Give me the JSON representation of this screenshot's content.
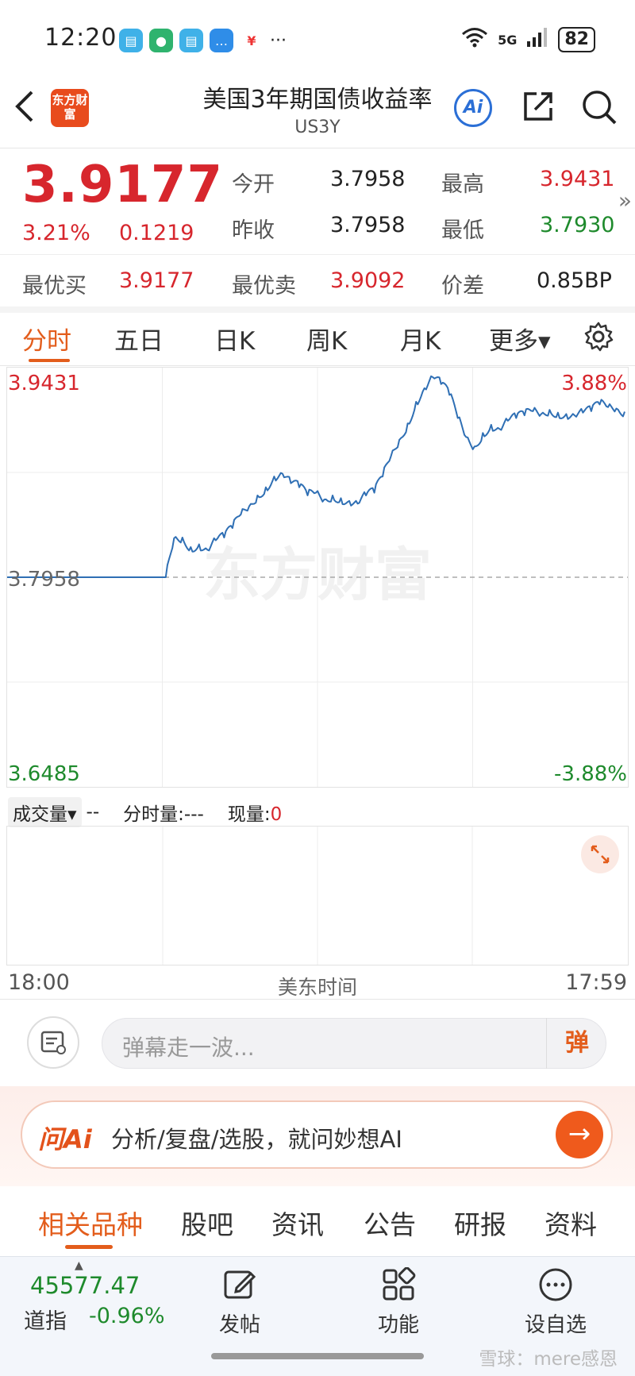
{
  "status_bar": {
    "time": "12:20",
    "network": "5G",
    "battery": "82",
    "more": "···"
  },
  "header": {
    "title": "美国3年期国债收益率",
    "code": "US3Y",
    "logo_text": "东方财富",
    "ai_label": "Ai"
  },
  "quote": {
    "price": "3.9177",
    "change_pct": "3.21%",
    "change_abs": "0.1219",
    "open_label": "今开",
    "open": "3.7958",
    "high_label": "最高",
    "high": "3.9431",
    "prev_close_label": "昨收",
    "prev_close": "3.7958",
    "low_label": "最低",
    "low": "3.7930",
    "best_bid_label": "最优买",
    "best_bid": "3.9177",
    "best_ask_label": "最优卖",
    "best_ask": "3.9092",
    "spread_label": "价差",
    "spread": "0.85BP",
    "more_arrow": "»"
  },
  "tabs": [
    {
      "label": "分时",
      "active": true
    },
    {
      "label": "五日"
    },
    {
      "label": "日K"
    },
    {
      "label": "周K"
    },
    {
      "label": "月K"
    },
    {
      "label": "更多▾"
    }
  ],
  "chart": {
    "y_top": "3.9431",
    "y_mid": "3.7958",
    "y_bottom": "3.6485",
    "pct_top": "3.88%",
    "pct_bottom": "-3.88%",
    "time_start": "18:00",
    "time_center": "美东时间",
    "time_end": "17:59",
    "watermark": "东方财富",
    "colors": {
      "line": "#2f6fb4",
      "up": "#d7262d",
      "down": "#1e8a2c"
    }
  },
  "chart_data": {
    "type": "line",
    "title": "",
    "xlabel": "美东时间",
    "ylabel": "",
    "ylim": [
      3.6485,
      3.9431
    ],
    "x_range": [
      "18:00",
      "17:59"
    ],
    "reference_line": 3.7958,
    "series": [
      {
        "values": [
          3.7958,
          3.7958,
          3.7958,
          3.7958,
          3.7958,
          3.7958,
          3.7958,
          3.7958,
          3.7958,
          3.7958,
          3.7958,
          3.7958,
          3.7958,
          3.7958,
          3.7958,
          3.7958,
          3.7958,
          3.7958,
          3.7958,
          3.7958,
          3.8245,
          3.825,
          3.818,
          3.82,
          3.816,
          3.823,
          3.825,
          3.832,
          3.842,
          3.848,
          3.856,
          3.862,
          3.87,
          3.872,
          3.865,
          3.862,
          3.856,
          3.858,
          3.853,
          3.856,
          3.854,
          3.852,
          3.85,
          3.856,
          3.858,
          3.87,
          3.885,
          3.897,
          3.909,
          3.925,
          3.935,
          3.9431,
          3.938,
          3.93,
          3.913,
          3.899,
          3.892,
          3.902,
          3.908,
          3.905,
          3.911,
          3.913,
          3.915,
          3.918,
          3.916,
          3.919,
          3.917,
          3.916,
          3.915,
          3.917,
          3.918,
          3.923,
          3.921,
          3.92,
          3.9177
        ]
      }
    ]
  },
  "volume_bar": {
    "selector": "成交量▾",
    "selector_value": "--",
    "fenshi_label": "分时量:",
    "fenshi_value": "---",
    "now_label": "现量:",
    "now_value": "0"
  },
  "danmu": {
    "placeholder": "弹幕走一波...",
    "send": "弹"
  },
  "ai_banner": {
    "logo": "问Ai",
    "text": "分析/复盘/选股，就问妙想AI",
    "go": "→"
  },
  "bottom_tabs": [
    {
      "label": "相关品种",
      "active": true
    },
    {
      "label": "股吧"
    },
    {
      "label": "资讯"
    },
    {
      "label": "公告"
    },
    {
      "label": "研报"
    },
    {
      "label": "资料"
    }
  ],
  "bottom_bar": {
    "index_value": "45577.47",
    "index_name": "道指",
    "index_change": "-0.96%",
    "nav": [
      {
        "label": "发帖",
        "icon": "edit-icon"
      },
      {
        "label": "功能",
        "icon": "grid-icon"
      },
      {
        "label": "设自选",
        "icon": "more-dots-icon"
      }
    ],
    "watermark": "雪球：mere感恩"
  }
}
